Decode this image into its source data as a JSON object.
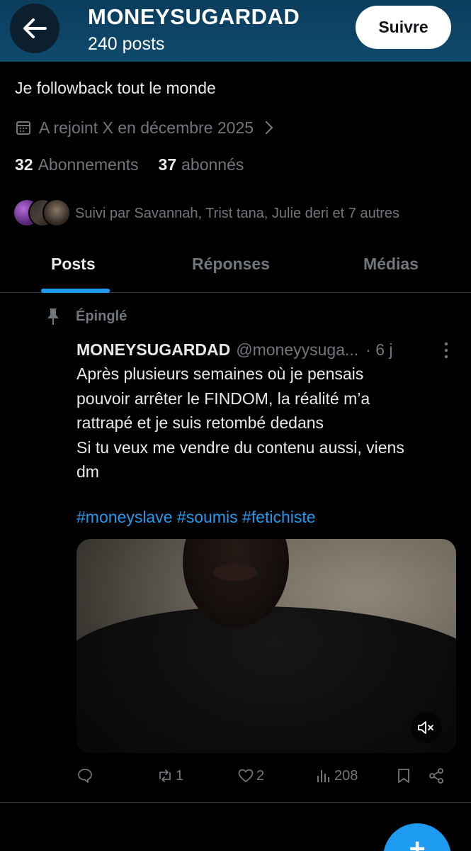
{
  "header": {
    "display_name": "MONEYSUGARDAD",
    "posts_count": "240 posts",
    "follow_label": "Suivre",
    "background_color": "#0e4a6e"
  },
  "profile": {
    "bio": "Je followback tout le monde",
    "joined": "A rejoint X en décembre 2025",
    "following_count": "32",
    "following_label": "Abonnements",
    "followers_count": "37",
    "followers_label": "abonnés",
    "followed_by": "Suivi par Savannah, Trist tana, Julie deri et 7 autres"
  },
  "tabs": [
    {
      "label": "Posts",
      "active": true
    },
    {
      "label": "Réponses",
      "active": false
    },
    {
      "label": "Médias",
      "active": false
    }
  ],
  "post": {
    "pinned_label": "Épinglé",
    "author": "MONEYSUGARDAD",
    "handle": "@moneyysuga...",
    "time": "· 6 j",
    "text": "Après plusieurs semaines où je pensais\npouvoir arrêter le FINDOM, la réalité m’a\nrattrapé et je suis retombé dedans\nSi tu veux me vendre du contenu aussi, viens\ndm",
    "hashtags": [
      "#moneyslave",
      "#soumis",
      "#fetichiste"
    ],
    "stats": {
      "replies": "",
      "reposts": "1",
      "likes": "2",
      "views": "208"
    }
  },
  "icons": {
    "back": "arrow-left-icon",
    "calendar": "calendar-icon",
    "pin": "pin-icon",
    "more": "more-vertical-icon",
    "mute": "volume-muted-icon",
    "reply": "reply-icon",
    "repost": "repost-icon",
    "like": "heart-icon",
    "views": "views-icon",
    "bookmark": "bookmark-icon",
    "share": "share-icon",
    "compose": "plus-icon"
  },
  "colors": {
    "accent": "#1d9bf0",
    "text_primary": "#e7e9ea",
    "text_secondary": "#71767b",
    "background": "#000000"
  }
}
